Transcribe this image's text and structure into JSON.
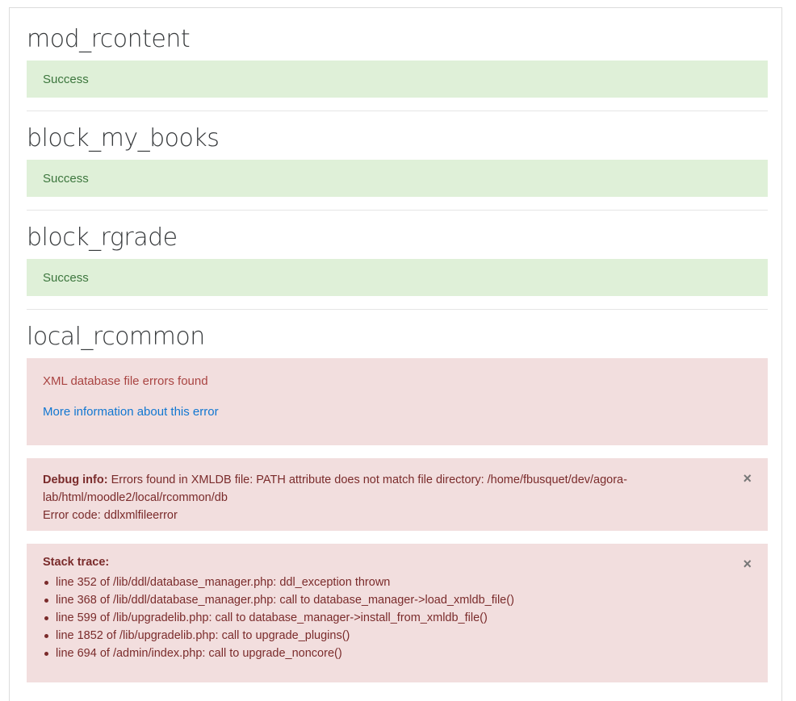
{
  "sections": [
    {
      "name": "mod_rcontent",
      "status": "Success"
    },
    {
      "name": "block_my_books",
      "status": "Success"
    },
    {
      "name": "block_rgrade",
      "status": "Success"
    },
    {
      "name": "local_rcommon"
    }
  ],
  "error": {
    "message": "XML database file errors found",
    "more_info_link": "More information about this error"
  },
  "debug": {
    "label": "Debug info:",
    "text_line1": "Errors found in XMLDB file: PATH attribute does not match file directory: /home/fbusquet/dev/agora-",
    "text_line2": "lab/html/moodle2/local/rcommon/db",
    "error_code": "Error code: ddlxmlfileerror",
    "close_glyph": "×"
  },
  "stack": {
    "label": "Stack trace:",
    "close_glyph": "×",
    "items": [
      "line 352 of /lib/ddl/database_manager.php: ddl_exception thrown",
      "line 368 of /lib/ddl/database_manager.php: call to database_manager->load_xmldb_file()",
      "line 599 of /lib/upgradelib.php: call to database_manager->install_from_xmldb_file()",
      "line 1852 of /lib/upgradelib.php: call to upgrade_plugins()",
      "line 694 of /admin/index.php: call to upgrade_noncore()"
    ]
  },
  "colors": {
    "success_bg": "#dff0d8",
    "success_text": "#3c763d",
    "error_bg": "#f2dede",
    "error_text": "#a94442",
    "link": "#1177d1"
  }
}
